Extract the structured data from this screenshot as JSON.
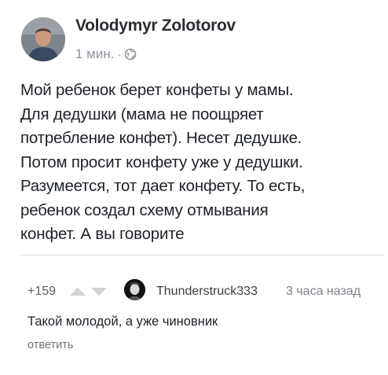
{
  "post": {
    "author": "Volodymyr Zolotorov",
    "time": "1 мин.",
    "separator": "·",
    "audience_icon": "globe-icon",
    "lines": [
      "Мой ребенок берет конфеты у мамы.",
      "Для дедушки (мама не поощряет",
      "потребление конфет). Несет дедушке.",
      "Потом просит конфету уже у дедушки.",
      "Разумеется, тот дает конфету. То есть,",
      "ребенок создал схему отмывания",
      "конфет. А вы говорите"
    ]
  },
  "comment": {
    "score": "+159",
    "upvote_icon": "upvote-arrow-icon",
    "downvote_icon": "downvote-arrow-icon",
    "author": "Thunderstruck333",
    "time": "3 часа назад",
    "text": "Такой молодой, а уже чиновник",
    "reply_label": "ответить"
  },
  "colors": {
    "meta_gray": "#8d949e",
    "vote_arrow": "#cfd2d6",
    "text_dark": "#1d2129"
  }
}
